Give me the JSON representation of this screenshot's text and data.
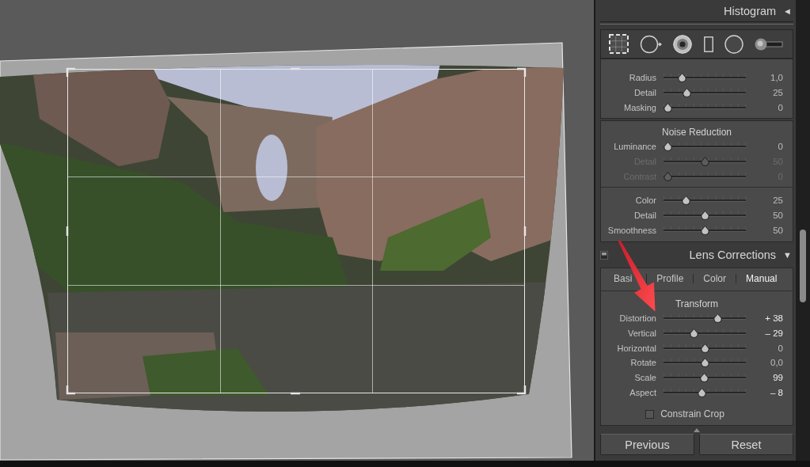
{
  "histogram_header": {
    "title": "Histogram",
    "toggle": "◄"
  },
  "tools": [
    {
      "kind": "crop"
    },
    {
      "kind": "spot"
    },
    {
      "kind": "redeye"
    },
    {
      "kind": "graduated"
    },
    {
      "kind": "radial"
    },
    {
      "kind": "brush"
    }
  ],
  "sharpening": {
    "rows": [
      {
        "label": "Radius",
        "value": "1,0",
        "level": 0.19
      },
      {
        "label": "Detail",
        "value": "25",
        "level": 0.26
      },
      {
        "label": "Masking",
        "value": "0",
        "level": 0
      }
    ]
  },
  "noise_reduction": {
    "title": "Noise Reduction",
    "luminance_rows": [
      {
        "label": "Luminance",
        "value": "0",
        "level": 0,
        "disabled": false
      },
      {
        "label": "Detail",
        "value": "50",
        "level": 0.5,
        "disabled": true
      },
      {
        "label": "Contrast",
        "value": "0",
        "level": 0,
        "disabled": true
      }
    ],
    "color_rows": [
      {
        "label": "Color",
        "value": "25",
        "level": 0.25,
        "disabled": false
      },
      {
        "label": "Detail",
        "value": "50",
        "level": 0.5,
        "disabled": false
      },
      {
        "label": "Smoothness",
        "value": "50",
        "level": 0.5,
        "disabled": false
      }
    ]
  },
  "lens_corrections": {
    "title": "Lens Corrections",
    "toggle": "▼",
    "tabs": [
      {
        "label": "Basi",
        "selected": false
      },
      {
        "label": "Profile",
        "selected": false
      },
      {
        "label": "Color",
        "selected": false
      },
      {
        "label": "Manual",
        "selected": true
      }
    ],
    "section_title": "Transform",
    "rows": [
      {
        "label": "Distortion",
        "value": "+ 38",
        "level": 0.68,
        "modified": true
      },
      {
        "label": "Vertical",
        "value": "– 29",
        "level": 0.36,
        "modified": true
      },
      {
        "label": "Horizontal",
        "value": "0",
        "level": 0.5,
        "modified": false
      },
      {
        "label": "Rotate",
        "value": "0,0",
        "level": 0.5,
        "modified": false
      },
      {
        "label": "Scale",
        "value": "99",
        "level": 0.49,
        "modified": true
      },
      {
        "label": "Aspect",
        "value": "– 8",
        "level": 0.46,
        "modified": true
      }
    ],
    "constrain_crop": {
      "label": "Constrain Crop",
      "checked": false
    }
  },
  "buttons": [
    "Previous",
    "Reset"
  ]
}
